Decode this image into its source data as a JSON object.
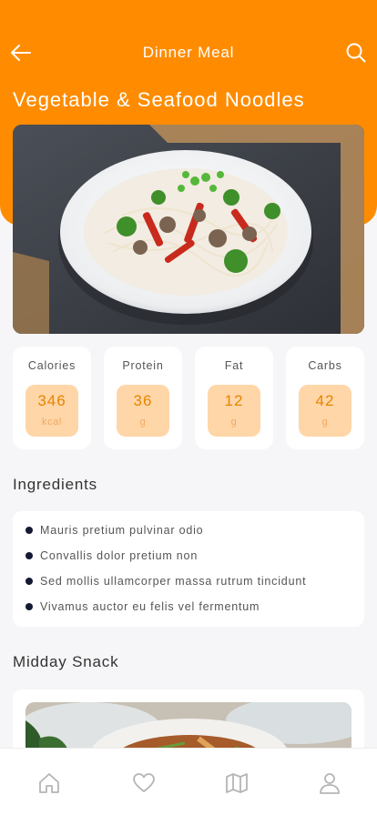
{
  "header": {
    "title": "Dinner Meal",
    "back_icon": "arrow-left-icon",
    "search_icon": "search-icon"
  },
  "dish": {
    "name": "Vegetable & Seafood Noodles"
  },
  "nutrition": [
    {
      "label": "Calories",
      "value": "346",
      "unit": "kcal"
    },
    {
      "label": "Protein",
      "value": "36",
      "unit": "g"
    },
    {
      "label": "Fat",
      "value": "12",
      "unit": "g"
    },
    {
      "label": "Carbs",
      "value": "42",
      "unit": "g"
    }
  ],
  "ingredients": {
    "title": "Ingredients",
    "items": [
      "Mauris pretium pulvinar odio",
      "Convallis dolor pretium non",
      "Sed mollis ullamcorper massa rutrum tincidunt",
      "Vivamus auctor eu felis vel fermentum"
    ]
  },
  "snack": {
    "title": "Midday Snack"
  },
  "bottom_nav": [
    "home-icon",
    "heart-icon",
    "map-icon",
    "user-icon"
  ],
  "colors": {
    "accent": "#ff8c00",
    "chip": "#ffd6a8",
    "value": "#e88400"
  }
}
